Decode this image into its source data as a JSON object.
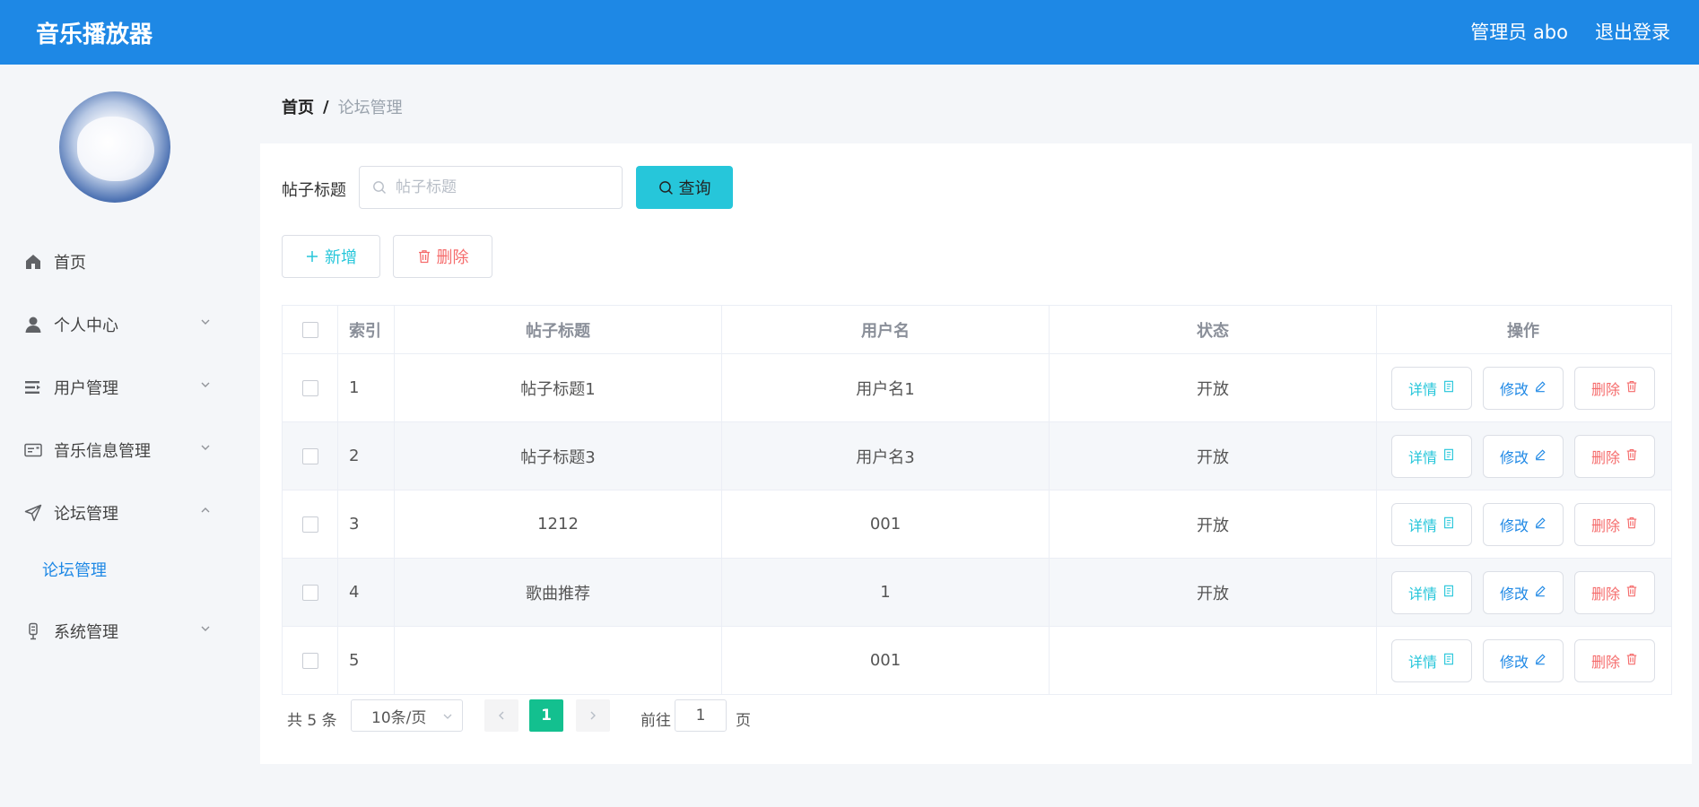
{
  "header": {
    "app_title": "音乐播放器",
    "admin_label": "管理员 abo",
    "logout_label": "退出登录"
  },
  "sidebar": {
    "items": [
      {
        "label": "首页",
        "icon": "home-icon"
      },
      {
        "label": "个人中心",
        "icon": "user-icon"
      },
      {
        "label": "用户管理",
        "icon": "list-icon"
      },
      {
        "label": "音乐信息管理",
        "icon": "card-icon"
      },
      {
        "label": "论坛管理",
        "icon": "send-icon"
      },
      {
        "label": "系统管理",
        "icon": "mic-icon"
      }
    ],
    "submenu_active": "论坛管理"
  },
  "breadcrumb": {
    "home": "首页",
    "separator": "/",
    "current": "论坛管理"
  },
  "search": {
    "label": "帖子标题",
    "placeholder": "帖子标题",
    "button": "查询"
  },
  "actions": {
    "add": "新增",
    "delete": "删除"
  },
  "table": {
    "headers": {
      "index": "索引",
      "title": "帖子标题",
      "username": "用户名",
      "status": "状态",
      "ops": "操作"
    },
    "op_labels": {
      "detail": "详情",
      "edit": "修改",
      "delete": "删除"
    },
    "rows": [
      {
        "index": "1",
        "title": "帖子标题1",
        "username": "用户名1",
        "status": "开放"
      },
      {
        "index": "2",
        "title": "帖子标题3",
        "username": "用户名3",
        "status": "开放"
      },
      {
        "index": "3",
        "title": "1212",
        "username": "001",
        "status": "开放"
      },
      {
        "index": "4",
        "title": "歌曲推荐",
        "username": "1",
        "status": "开放"
      },
      {
        "index": "5",
        "title": "",
        "username": "001",
        "status": ""
      }
    ]
  },
  "pagination": {
    "total": "共 5 条",
    "page_size": "10条/页",
    "current_page": "1",
    "goto_label": "前往",
    "goto_value": "1",
    "page_suffix": "页"
  },
  "colors": {
    "header_bg": "#1e88e5",
    "primary_cyan": "#26c6da",
    "danger": "#f56c6c",
    "active_page": "#13c08f"
  }
}
